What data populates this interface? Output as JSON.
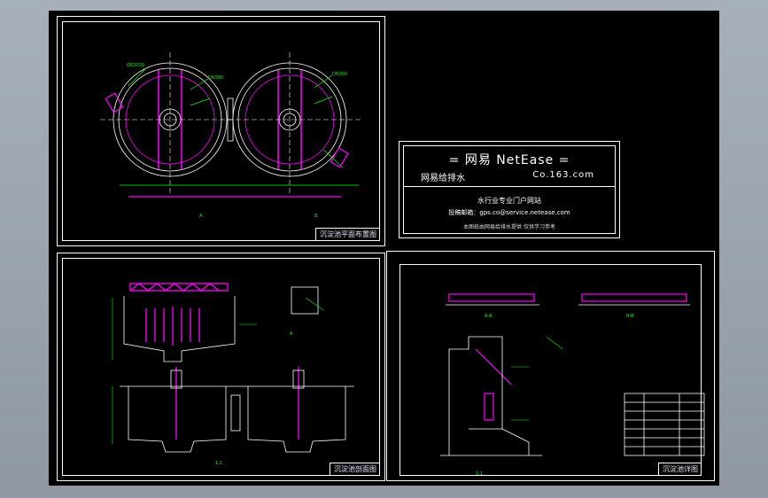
{
  "sheets": {
    "plan_title": "沉淀池平面布置图",
    "section_title": "沉淀池剖面图",
    "detail_title": "沉淀池详图"
  },
  "logo": {
    "line1": "= 网易 NetEase =",
    "line2_left": "网易给排水",
    "line2_right": "Co.163.com",
    "line3": "水行业专业门户网站",
    "line4": "投稿邮箱：gps.co@service.netease.com",
    "line5": "本图纸由网易给排水提供 仅供学习参考"
  },
  "colors": {
    "model_bg": "#000000",
    "frame": "#ffffff",
    "magenta": "#ff00ff",
    "green": "#00ff00",
    "white": "#ffffff"
  }
}
